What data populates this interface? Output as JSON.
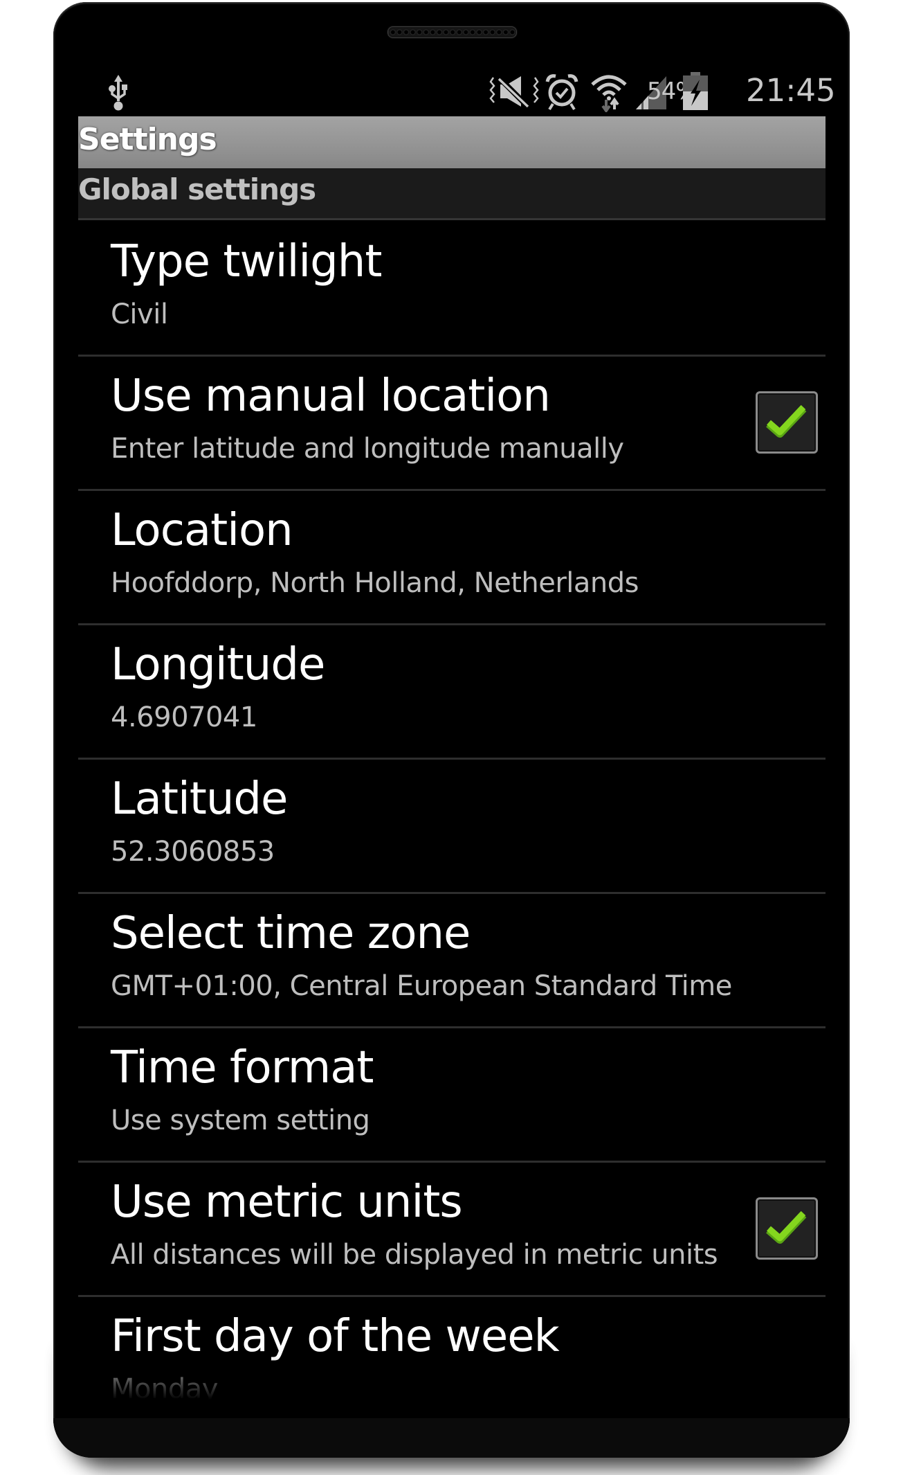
{
  "status_bar": {
    "icons": [
      "usb-icon",
      "vibrate-mute-icon",
      "alarm-icon",
      "wifi-icon",
      "signal-icon",
      "battery-charging-icon"
    ],
    "battery_percent": "54%",
    "battery_level": 0.54,
    "time": "21:45"
  },
  "app_bar": {
    "title": "Settings"
  },
  "section": {
    "header": "Global settings"
  },
  "settings": [
    {
      "title": "Type twilight",
      "summary": "Civil",
      "checkbox": null
    },
    {
      "title": "Use manual location",
      "summary": "Enter latitude and longitude manually",
      "checkbox": true
    },
    {
      "title": "Location",
      "summary": "Hoofddorp, North Holland, Netherlands",
      "checkbox": null
    },
    {
      "title": "Longitude",
      "summary": "4.6907041",
      "checkbox": null
    },
    {
      "title": "Latitude",
      "summary": "52.3060853",
      "checkbox": null
    },
    {
      "title": "Select time zone",
      "summary": "GMT+01:00, Central European Standard Time",
      "checkbox": null
    },
    {
      "title": "Time format",
      "summary": "Use system setting",
      "checkbox": null
    },
    {
      "title": "Use metric units",
      "summary": "All distances will be displayed in metric units",
      "checkbox": true
    },
    {
      "title": "First day of the week",
      "summary": "Monday",
      "checkbox": null
    }
  ],
  "colors": {
    "checkmark": "#7ccf1e",
    "title_text": "#ffffff",
    "summary_text": "#bebebe",
    "background": "#000000"
  }
}
